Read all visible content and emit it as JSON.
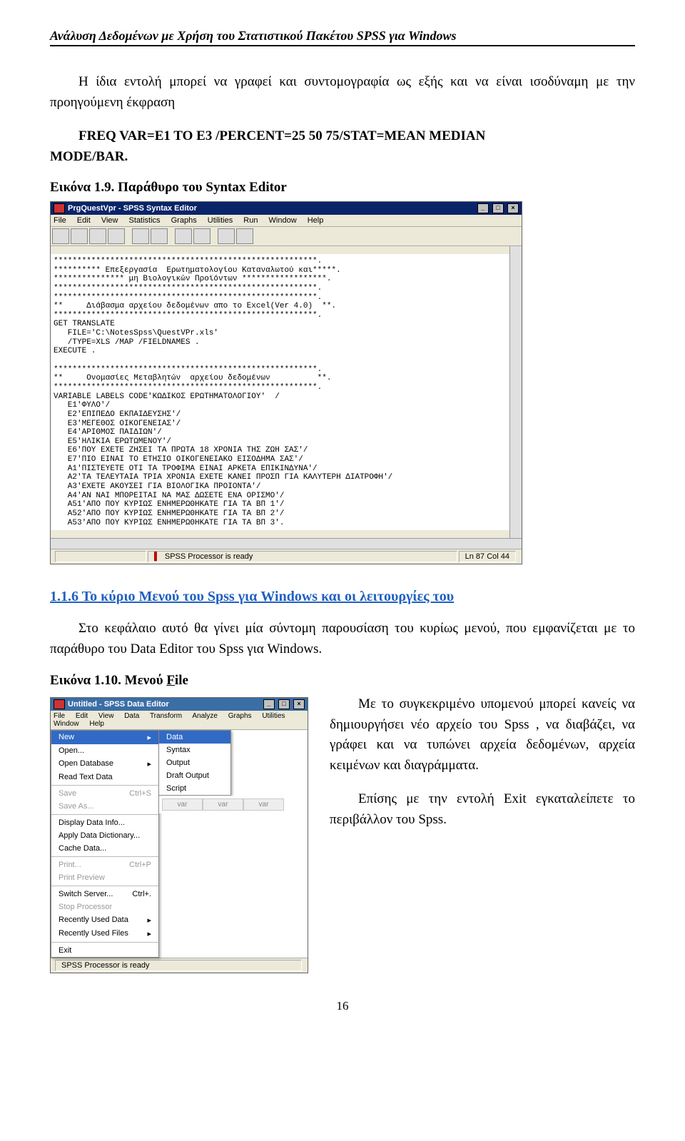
{
  "header": "Ανάλυση Δεδομένων με Χρήση του Στατιστικού Πακέτου SPSS  για Windows",
  "para1": "Η ίδια  εντολή μπορεί να γραφεί και συντομογραφία ως εξής και να είναι ισοδύναμη με την προηγούμενη έκφραση",
  "code1": "FREQ VAR=E1 TO E3 /PERCENT=25 50 75/STAT=MEAN MEDIAN",
  "code2": "MODE/BAR.",
  "caption1": "Εικόνα 1.9. Παράθυρο του Syntax  Editor",
  "syntax_window": {
    "title": "PrgQuestVpr - SPSS Syntax Editor",
    "menu": [
      "File",
      "Edit",
      "View",
      "Statistics",
      "Graphs",
      "Utilities",
      "Run",
      "Window",
      "Help"
    ],
    "lines": [
      "********************************************************.",
      "********** Επεξεργασία  Ερωτηματολογίου Καταναλωτού και*****.",
      "*************** μη Βιολογικών Προϊόντων ******************.",
      "********************************************************.",
      "********************************************************.",
      "**     Διάβασμα αρχείου δεδομένων απο το Excel(Ver 4.0)  **.",
      "********************************************************.",
      "GET TRANSLATE",
      "   FILE='C:\\NotesSpss\\QuestVPr.xls'",
      "   /TYPE=XLS /MAP /FIELDNAMES .",
      "EXECUTE .",
      "",
      "********************************************************.",
      "**     Ονομασίες Μεταβλητών  αρχείου δεδομένων          **.",
      "********************************************************.",
      "VARIABLE LABELS CODE'ΚΩΔΙΚΟΣ ΕΡΩΤΗΜΑΤΟΛΟΓΙΟΥ'  /",
      "   E1'ΦΥΛΟ'/",
      "   E2'ΕΠΙΠΕΔΟ ΕΚΠΑΙΔΕΥΣΗΣ'/",
      "   E3'ΜΕΓΕΘΟΣ ΟΙΚΟΓΕΝΕΙΑΣ'/",
      "   E4'ΑΡΙΘΜΟΣ ΠΑΙΔΙΩΝ'/",
      "   E5'ΗΛΙΚΙΑ ΕΡΩΤΩΜΕΝΟΥ'/",
      "   E6'ΠΟΥ ΕΧΕΤΕ ΖΗΣΕΙ ΤΑ ΠΡΩΤΑ 18 ΧΡΟΝΙΑ ΤΗΣ ΖΩΗ ΣΑΣ'/",
      "   E7'ΠΙΟ ΕΙΝΑΙ ΤΟ ΕΤΗΣΙΟ ΟΙΚΟΓΕΝΕΙΑΚΟ ΕΙΣΟΔΗΜΑ ΣΑΣ'/",
      "   A1'ΠΙΣΤΕΥΕΤΕ ΟΤΙ ΤΑ ΤΡΟΦΙΜΑ ΕΙΝΑΙ ΑΡΚΕΤΑ ΕΠΙΚΙΝΔΥΝΑ'/",
      "   A2'ΤΑ ΤΕΛΕΥΤΑΙΑ ΤΡΙΑ ΧΡΟΝΙΑ ΕΧΕΤΕ ΚΑΝΕΙ ΠΡΟΣΠ ΓΙΑ ΚΑΛΥΤΕΡΗ ΔΙΑΤΡΟΦΗ'/",
      "   A3'ΕΧΕΤΕ ΑΚΟΥΣΕΙ ΓΙΑ ΒΙΟΛΟΓΙΚΑ ΠΡΟΙΟΝΤΑ'/",
      "   A4'ΑΝ ΝΑΙ ΜΠΟΡΕΙΤΑΙ ΝΑ ΜΑΣ ΔΩΣΕΤΕ ΕΝΑ ΟΡΙΣΜΟ'/",
      "   A51'ΑΠΟ ΠΟΥ ΚΥΡΙΩΣ ΕΝΗΜΕΡΩΘΗΚΑΤΕ ΓΙΑ ΤΑ ΒΠ 1'/",
      "   A52'ΑΠΟ ΠΟΥ ΚΥΡΙΩΣ ΕΝΗΜΕΡΩΘΗΚΑΤΕ ΓΙΑ ΤΑ ΒΠ 2'/",
      "   A53'ΑΠΟ ΠΟΥ ΚΥΡΙΩΣ ΕΝΗΜΕΡΩΘΗΚΑΤΕ ΓΙΑ ΤΑ ΒΠ 3'."
    ],
    "status_center": "SPSS Processor is ready",
    "status_right": "Ln 87 Col 44"
  },
  "section_title": "1.1.6 Το κύριο  Μενού του Spss για Windows και οι λειτουργίες του",
  "para2": "Στο   κεφάλαιο   αυτό θα γίνει μία σύντομη   παρουσίαση του κυρίως μενού, που εμφανίζεται με το παράθυρο του Data Editor του Spss για Windows.",
  "caption2_a": "Εικόνα 1.10. Μενού ",
  "caption2_b": "F",
  "caption2_c": "ile",
  "para3a": "Με το συγκεκριμένο υπομενού μπορεί κανείς να  δημιουργήσει νέο αρχείο του Spss ,  να   διαβάζει, να  γράφει  και  να  τυπώνει αρχεία  δεδομένων,  αρχεία  κειμένων  και διαγράμματα.",
  "para3b": "Επίσης    με    την    εντολή       Exit εγκαταλείπετε το περιβάλλον του  Spss.",
  "data_editor": {
    "title": "Untitled - SPSS Data Editor",
    "menu": [
      "File",
      "Edit",
      "View",
      "Data",
      "Transform",
      "Analyze",
      "Graphs",
      "Utilities",
      "Window",
      "Help"
    ],
    "file_items": [
      {
        "label": "New",
        "arrow": "▸",
        "hl": true
      },
      {
        "label": "Open...",
        "shortcut": ""
      },
      {
        "label": "Open Database",
        "arrow": "▸"
      },
      {
        "label": "Read Text Data",
        "shortcut": ""
      },
      {
        "sep": true
      },
      {
        "label": "Save",
        "shortcut": "Ctrl+S",
        "disabled": true
      },
      {
        "label": "Save As...",
        "disabled": true
      },
      {
        "sep": true
      },
      {
        "label": "Display Data Info...",
        "shortcut": ""
      },
      {
        "label": "Apply Data Dictionary...",
        "shortcut": ""
      },
      {
        "label": "Cache Data...",
        "shortcut": ""
      },
      {
        "sep": true
      },
      {
        "label": "Print...",
        "shortcut": "Ctrl+P",
        "disabled": true
      },
      {
        "label": "Print Preview",
        "disabled": true
      },
      {
        "sep": true
      },
      {
        "label": "Switch Server...",
        "shortcut": "Ctrl+.",
        "disabled": false
      },
      {
        "label": "Stop Processor",
        "disabled": true
      },
      {
        "label": "Recently Used Data",
        "arrow": "▸"
      },
      {
        "label": "Recently Used Files",
        "arrow": "▸"
      },
      {
        "sep": true
      },
      {
        "label": "Exit",
        "shortcut": ""
      }
    ],
    "new_sub": [
      "Data",
      "Syntax",
      "Output",
      "Draft Output",
      "Script"
    ],
    "grid_cols": [
      "var",
      "var",
      "var"
    ],
    "status": "SPSS Processor is ready"
  },
  "page_num": "16"
}
